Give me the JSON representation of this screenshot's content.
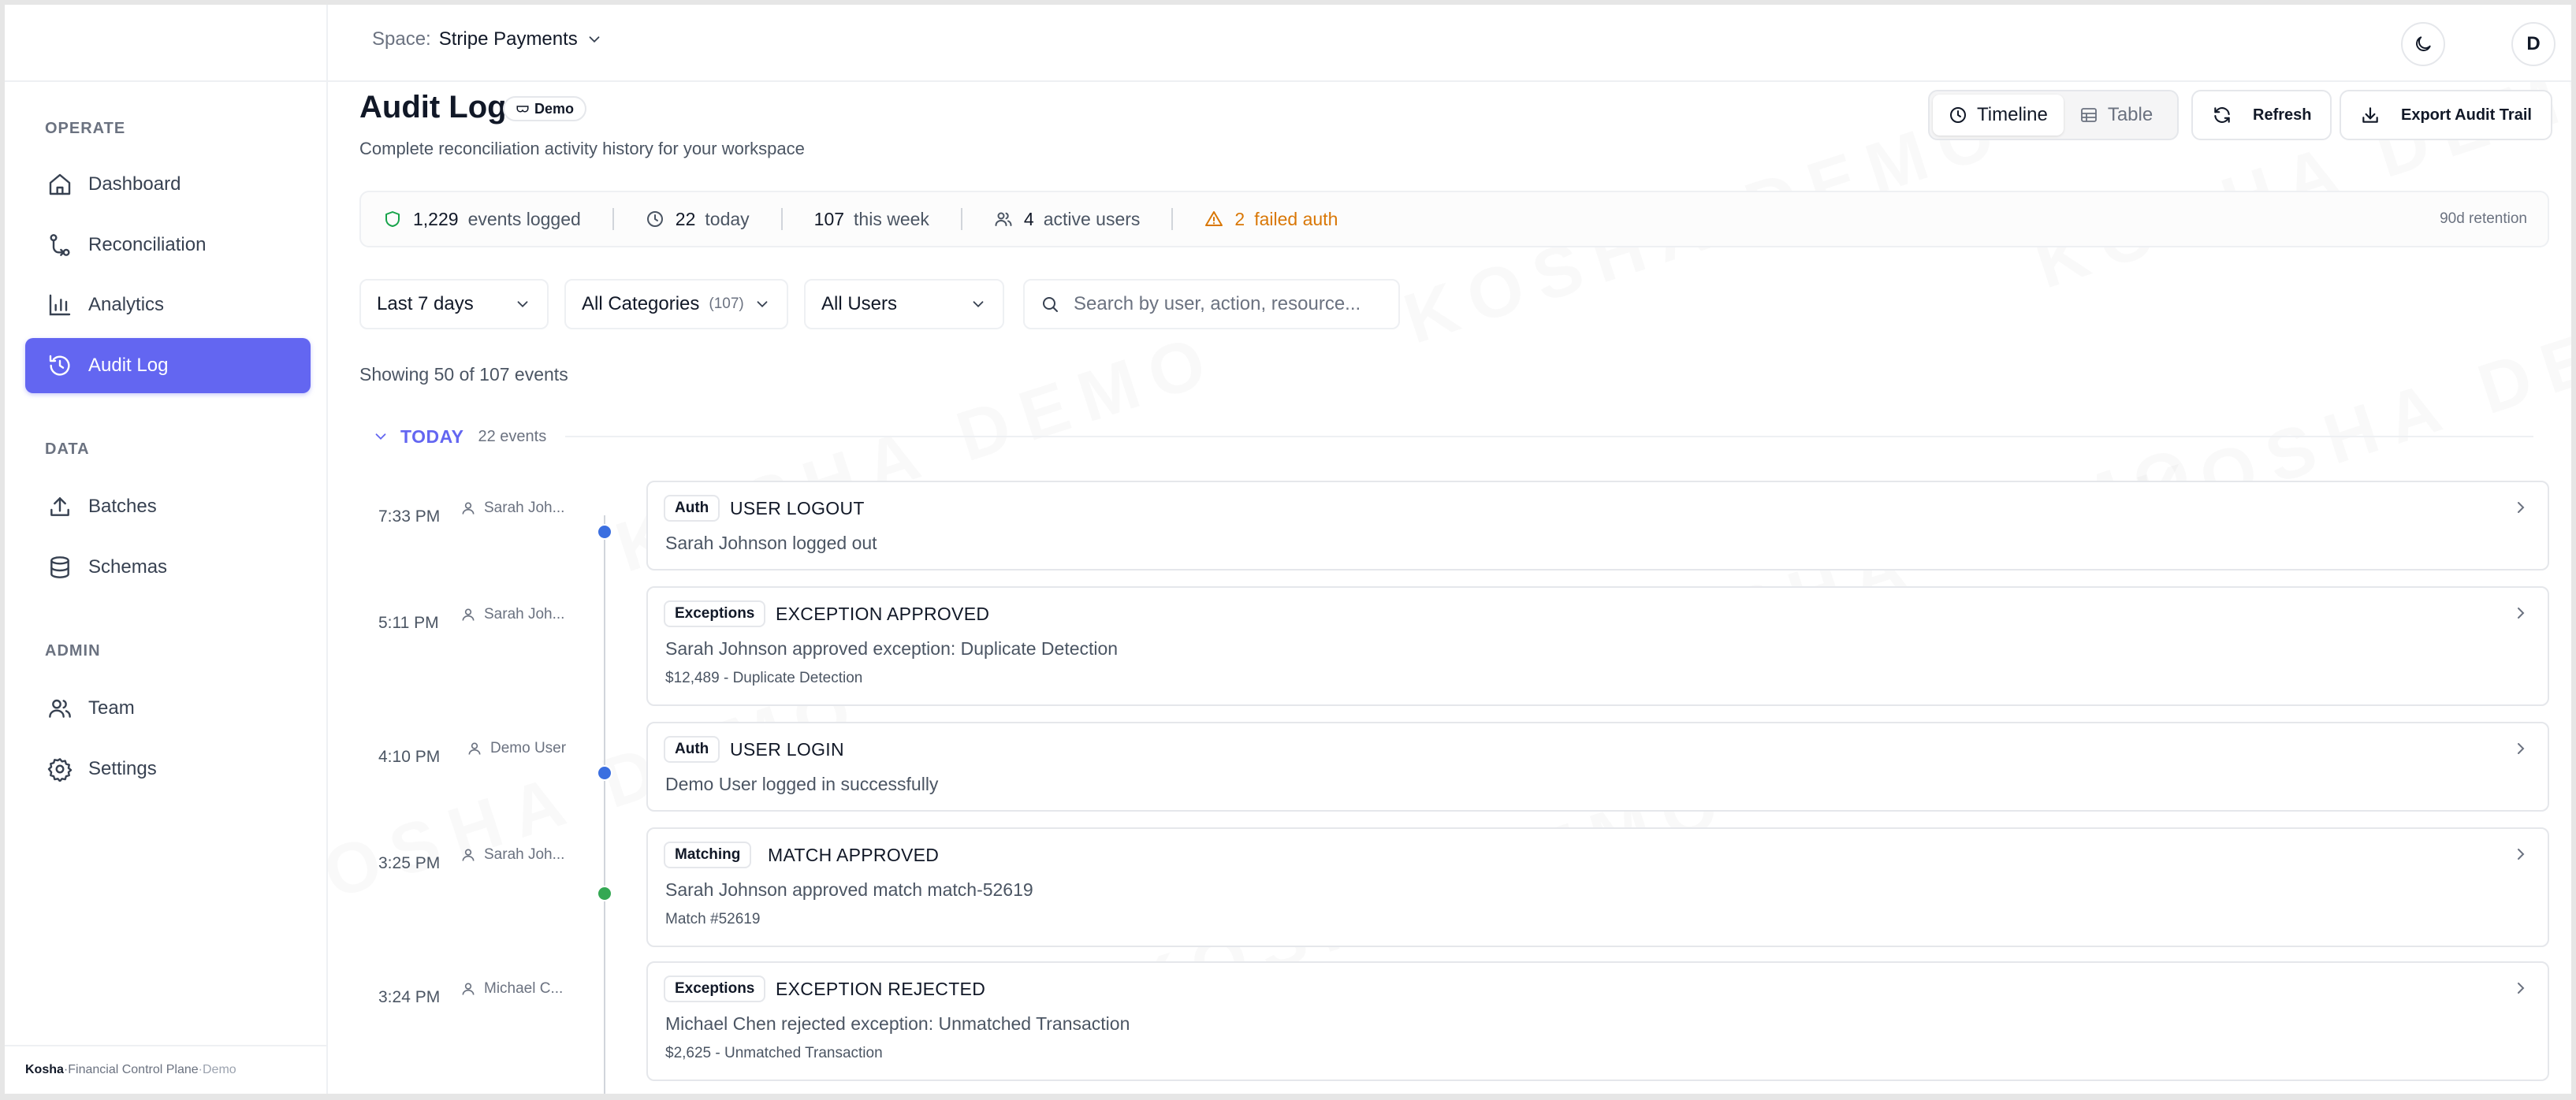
{
  "app": {
    "name": "Kosha",
    "tagline": "Financial Control Plane",
    "env": "Demo"
  },
  "sidebar": {
    "sections": [
      {
        "title": "OPERATE",
        "items": [
          {
            "label": "Dashboard",
            "icon": "home-icon"
          },
          {
            "label": "Reconciliation",
            "icon": "git-compare-icon"
          },
          {
            "label": "Analytics",
            "icon": "bar-chart-icon"
          },
          {
            "label": "Audit Log",
            "icon": "history-icon",
            "active": true
          }
        ]
      },
      {
        "title": "DATA",
        "items": [
          {
            "label": "Batches",
            "icon": "upload-icon"
          },
          {
            "label": "Schemas",
            "icon": "database-icon"
          }
        ]
      },
      {
        "title": "ADMIN",
        "items": [
          {
            "label": "Team",
            "icon": "users-icon"
          },
          {
            "label": "Settings",
            "icon": "gear-icon"
          }
        ]
      }
    ]
  },
  "footer": {
    "brand": "Kosha",
    "sep1": " · ",
    "tagline": "Financial Control Plane",
    "sep2": " · ",
    "env": "Demo"
  },
  "topbar": {
    "space_label": "Space:",
    "space_name": "Stripe Payments",
    "avatar_initial": "D"
  },
  "page": {
    "title": "Audit Log",
    "badge": "Demo",
    "subtitle": "Complete reconciliation activity history for your workspace",
    "watermark": "KOSHA DEMO"
  },
  "view_toggle": {
    "timeline": "Timeline",
    "table": "Table",
    "selected": "timeline"
  },
  "actions": {
    "refresh": "Refresh",
    "export": "Export Audit Trail"
  },
  "stats": {
    "events_logged": {
      "value": "1,229",
      "label": "events logged"
    },
    "today": {
      "value": "22",
      "label": "today"
    },
    "this_week": {
      "value": "107",
      "label": "this week"
    },
    "active_users": {
      "value": "4",
      "label": "active users"
    },
    "failed_auth": {
      "value": "2",
      "label": "failed auth"
    },
    "retention": "90d retention"
  },
  "filters": {
    "date_range": "Last 7 days",
    "category": "All Categories",
    "category_count": "(107)",
    "users": "All Users",
    "search_placeholder": "Search by user, action, resource..."
  },
  "showing": "Showing 50 of 107 events",
  "colors": {
    "accent": "#6366f1",
    "auth_dot": "#3b6fe0",
    "matching_dot": "#34a853",
    "warning": "#d97706"
  },
  "group": {
    "title": "TODAY",
    "count": "22 events"
  },
  "events": [
    {
      "time": "7:33 PM",
      "user": "Sarah Joh...",
      "category": "Auth",
      "action": "USER LOGOUT",
      "description": "Sarah Johnson logged out",
      "meta": ""
    },
    {
      "time": "5:11 PM",
      "user": "Sarah Joh...",
      "category": "Exceptions",
      "action": "EXCEPTION APPROVED",
      "description": "Sarah Johnson approved exception: Duplicate Detection",
      "meta": "$12,489 - Duplicate Detection"
    },
    {
      "time": "4:10 PM",
      "user": "Demo User",
      "category": "Auth",
      "action": "USER LOGIN",
      "description": "Demo User logged in successfully",
      "meta": ""
    },
    {
      "time": "3:25 PM",
      "user": "Sarah Joh...",
      "category": "Matching",
      "action": "MATCH APPROVED",
      "description": "Sarah Johnson approved match match-52619",
      "meta": "Match #52619"
    },
    {
      "time": "3:24 PM",
      "user": "Michael C...",
      "category": "Exceptions",
      "action": "EXCEPTION REJECTED",
      "description": "Michael Chen rejected exception: Unmatched Transaction",
      "meta": "$2,625 - Unmatched Transaction"
    }
  ]
}
